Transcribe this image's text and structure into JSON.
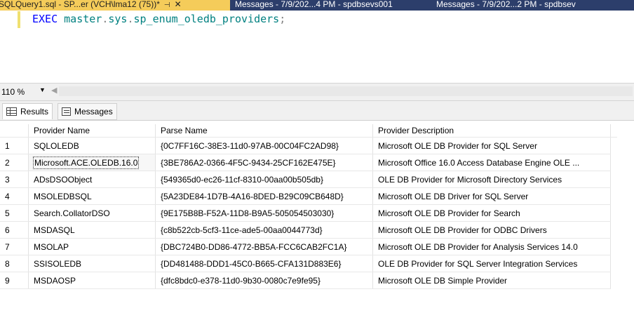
{
  "tabs": {
    "active": {
      "label": "SQLQuery1.sql - SP...er (VCH\\lma12 (75))*",
      "pin": "⊣",
      "close": "✕"
    },
    "messages1": "Messages - 7/9/202...4 PM - spdbsevs001",
    "messages2": "Messages - 7/9/202...2 PM - spdbsev"
  },
  "editor": {
    "kw": "EXEC",
    "obj1": "master",
    "dot1": ".",
    "obj2": "sys",
    "dot2": ".",
    "obj3": "sp_enum_oledb_providers",
    "semi": ";"
  },
  "zoom": {
    "value": "110 %",
    "dropdown": "▼",
    "scroll_left": "◀"
  },
  "result_tabs": {
    "results": "Results",
    "messages": "Messages"
  },
  "columns": [
    "Provider Name",
    "Parse Name",
    "Provider Description"
  ],
  "rows": [
    [
      "1",
      "SQLOLEDB",
      "{0C7FF16C-38E3-11d0-97AB-00C04FC2AD98}",
      "Microsoft OLE DB Provider for SQL Server"
    ],
    [
      "2",
      "Microsoft.ACE.OLEDB.16.0",
      "{3BE786A2-0366-4F5C-9434-25CF162E475E}",
      "Microsoft Office 16.0 Access Database Engine OLE ..."
    ],
    [
      "3",
      "ADsDSOObject",
      "{549365d0-ec26-11cf-8310-00aa00b505db}",
      "OLE DB Provider for Microsoft Directory Services"
    ],
    [
      "4",
      "MSOLEDBSQL",
      "{5A23DE84-1D7B-4A16-8DED-B29C09CB648D}",
      "Microsoft OLE DB Driver for SQL Server"
    ],
    [
      "5",
      "Search.CollatorDSO",
      "{9E175B8B-F52A-11D8-B9A5-505054503030}",
      "Microsoft OLE DB Provider for Search"
    ],
    [
      "6",
      "MSDASQL",
      "{c8b522cb-5cf3-11ce-ade5-00aa0044773d}",
      "Microsoft OLE DB Provider for ODBC Drivers"
    ],
    [
      "7",
      "MSOLAP",
      "{DBC724B0-DD86-4772-BB5A-FCC6CAB2FC1A}",
      "Microsoft OLE DB Provider for Analysis Services 14.0"
    ],
    [
      "8",
      "SSISOLEDB",
      "{DD481488-DDD1-45C0-B665-CFA131D883E6}",
      "OLE DB Provider for SQL Server Integration Services"
    ],
    [
      "9",
      "MSDAOSP",
      "{dfc8bdc0-e378-11d0-9b30-0080c7e9fe95}",
      "Microsoft OLE DB Simple Provider"
    ]
  ]
}
